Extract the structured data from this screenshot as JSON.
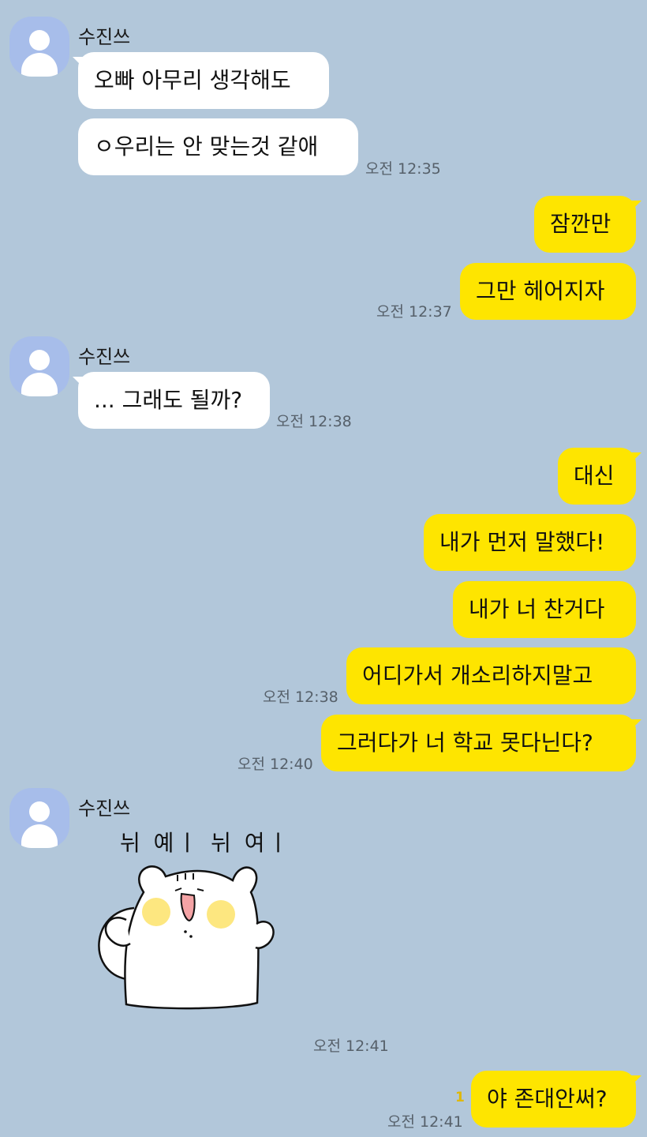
{
  "chat": {
    "partner_name": "수진쓰",
    "messages": [
      {
        "side": "in",
        "text": "오빠 아무리 생각해도"
      },
      {
        "side": "in",
        "text": "ㅇ우리는 안 맞는것 같애",
        "time": "오전 12:35"
      },
      {
        "side": "out",
        "text": "잠깐만"
      },
      {
        "side": "out",
        "text": "그만 헤어지자",
        "time": "오전 12:37"
      },
      {
        "side": "in",
        "text": "... 그래도 될까?",
        "time": "오전 12:38"
      },
      {
        "side": "out",
        "text": "대신"
      },
      {
        "side": "out",
        "text": "내가 먼저 말했다!"
      },
      {
        "side": "out",
        "text": "내가 너 찬거다"
      },
      {
        "side": "out",
        "text": "어디가서 개소리하지말고",
        "time": "오전 12:38"
      },
      {
        "side": "out",
        "text": "그러다가 너 학교 못다닌다?",
        "time": "오전 12:40"
      },
      {
        "side": "in",
        "sticker": "white-hamster-sticker",
        "sticker_caption": "뉘 예ㅣ 뉘 여ㅣ",
        "time": "오전 12:41"
      },
      {
        "side": "out",
        "text": "야 존대안써?",
        "time": "오전 12:41",
        "unread_count": "1"
      }
    ]
  },
  "colors": {
    "background": "#b2c7da",
    "incoming_bubble": "#ffffff",
    "outgoing_bubble": "#fee500",
    "avatar": "#a7bdea",
    "unread": "#e0b800"
  }
}
